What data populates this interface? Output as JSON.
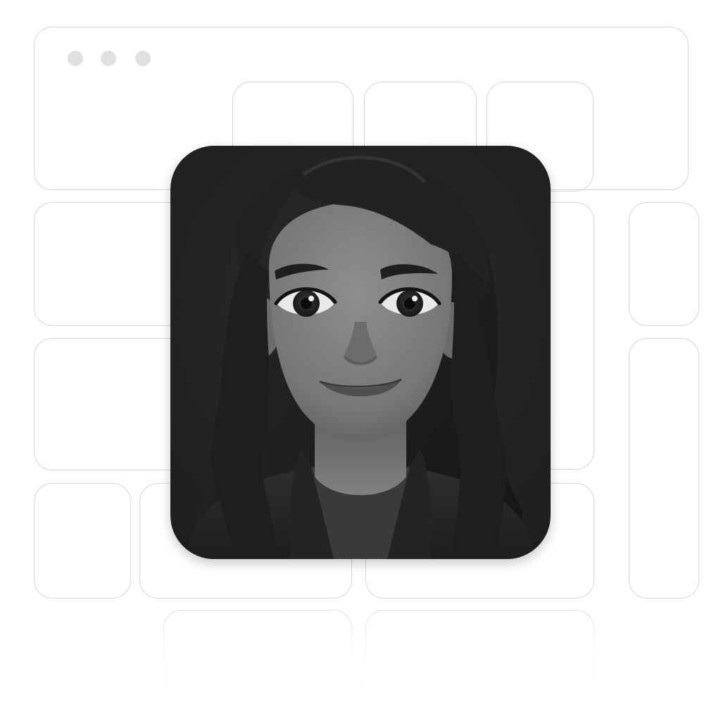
{
  "colors": {
    "background": "#ffffff",
    "wireframe_stroke": "#d7d7d7",
    "window_dot": "#e0e0e0",
    "tile_background": "#252525",
    "hair": "#1c1c1c",
    "skin": "#7d7d7d",
    "jacket": "#262626",
    "shirt": "#3a3a3a"
  },
  "window_controls": [
    {
      "name": "window-dot-1"
    },
    {
      "name": "window-dot-2"
    },
    {
      "name": "window-dot-3"
    }
  ],
  "icons": {
    "avatar": "memoji-woman-avatar-icon"
  }
}
